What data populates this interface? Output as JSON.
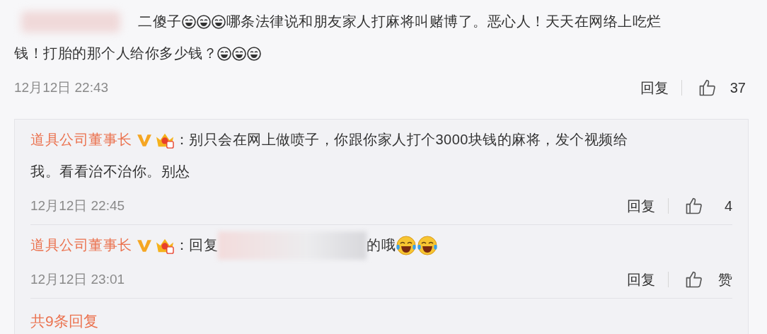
{
  "comment": {
    "author_blurred": true,
    "lines": [
      [
        {
          "kind": "text",
          "text": "二傻子"
        },
        {
          "kind": "grin"
        },
        {
          "kind": "grin"
        },
        {
          "kind": "grin"
        },
        {
          "kind": "text",
          "text": "哪条法律说和朋友家人打麻将叫赌博了。恶心人！天天在网络上吃烂"
        }
      ],
      [
        {
          "kind": "text",
          "text": "钱！打胎的那个人给你多少钱？"
        },
        {
          "kind": "grin"
        },
        {
          "kind": "grin"
        },
        {
          "kind": "grin"
        }
      ]
    ],
    "time": "12月12日 22:43",
    "reply_label": "回复",
    "likes": "37"
  },
  "replies": [
    {
      "author": "道具公司董事长",
      "verified": true,
      "crown": true,
      "colon": "：",
      "lines": [
        [
          {
            "kind": "text",
            "text": "别只会在网上做喷子，你跟你家人打个3000块钱的麻将，发个视频给"
          }
        ],
        [
          {
            "kind": "text",
            "text": "我。看看治不治你。别怂"
          }
        ]
      ],
      "time": "12月12日 22:45",
      "reply_label": "回复",
      "likes": "4"
    },
    {
      "author": "道具公司董事长",
      "verified": true,
      "crown": true,
      "colon": "：",
      "lines": [
        [
          {
            "kind": "text",
            "text": "回复"
          },
          {
            "kind": "blur"
          },
          {
            "kind": "text",
            "text": "的哦"
          },
          {
            "kind": "tears"
          },
          {
            "kind": "tears"
          }
        ]
      ],
      "time": "12月12日 23:01",
      "reply_label": "回复",
      "likes": "赞"
    }
  ],
  "more_replies": "共9条回复"
}
